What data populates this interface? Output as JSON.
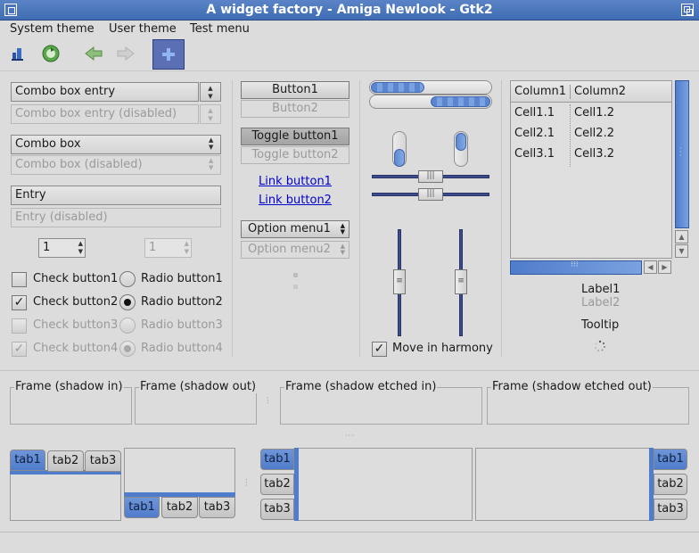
{
  "window": {
    "title": "A widget factory - Amiga Newlook - Gtk2"
  },
  "menubar": {
    "items": [
      {
        "label": "System theme"
      },
      {
        "label": "User theme"
      },
      {
        "label": "Test menu"
      }
    ]
  },
  "toolbar": {
    "icons": [
      "home-icon",
      "refresh-icon",
      "back-arrow-icon",
      "forward-arrow-icon",
      "add-icon"
    ]
  },
  "col1": {
    "combo_entry": "Combo box entry",
    "combo_entry_dis": "Combo box entry (disabled)",
    "combo": "Combo box",
    "combo_dis": "Combo box (disabled)",
    "entry": "Entry",
    "entry_dis": "Entry (disabled)",
    "spin1": "1",
    "spin2": "1",
    "check1": "Check button1",
    "check2": "Check button2",
    "check3": "Check button3",
    "check4": "Check button4",
    "radio1": "Radio button1",
    "radio2": "Radio button2",
    "radio3": "Radio button3",
    "radio4": "Radio button4"
  },
  "col2": {
    "button1": "Button1",
    "button2": "Button2",
    "toggle1": "Toggle button1",
    "toggle2": "Toggle button2",
    "link1": "Link button1",
    "link2": "Link button2",
    "option1": "Option menu1",
    "option2": "Option menu2"
  },
  "col3": {
    "progress1": 0.45,
    "progress2": 0.5,
    "harmony": "Move in harmony"
  },
  "tree": {
    "columns": [
      "Column1",
      "Column2"
    ],
    "rows": [
      [
        "Cell1.1",
        "Cell1.2"
      ],
      [
        "Cell2.1",
        "Cell2.2"
      ],
      [
        "Cell3.1",
        "Cell3.2"
      ]
    ]
  },
  "labels": {
    "label1": "Label1",
    "label2": "Label2",
    "tooltip": "Tooltip"
  },
  "frames": {
    "f1": "Frame (shadow in)",
    "f2": "Frame (shadow out)",
    "f3": "Frame (shadow etched in)",
    "f4": "Frame (shadow etched out)"
  },
  "tabs": {
    "t1": "tab1",
    "t2": "tab2",
    "t3": "tab3"
  },
  "colors": {
    "accent": "#4f7ccb",
    "title_bar": "#4a74bb",
    "slider_track": "#3d4a8c"
  }
}
